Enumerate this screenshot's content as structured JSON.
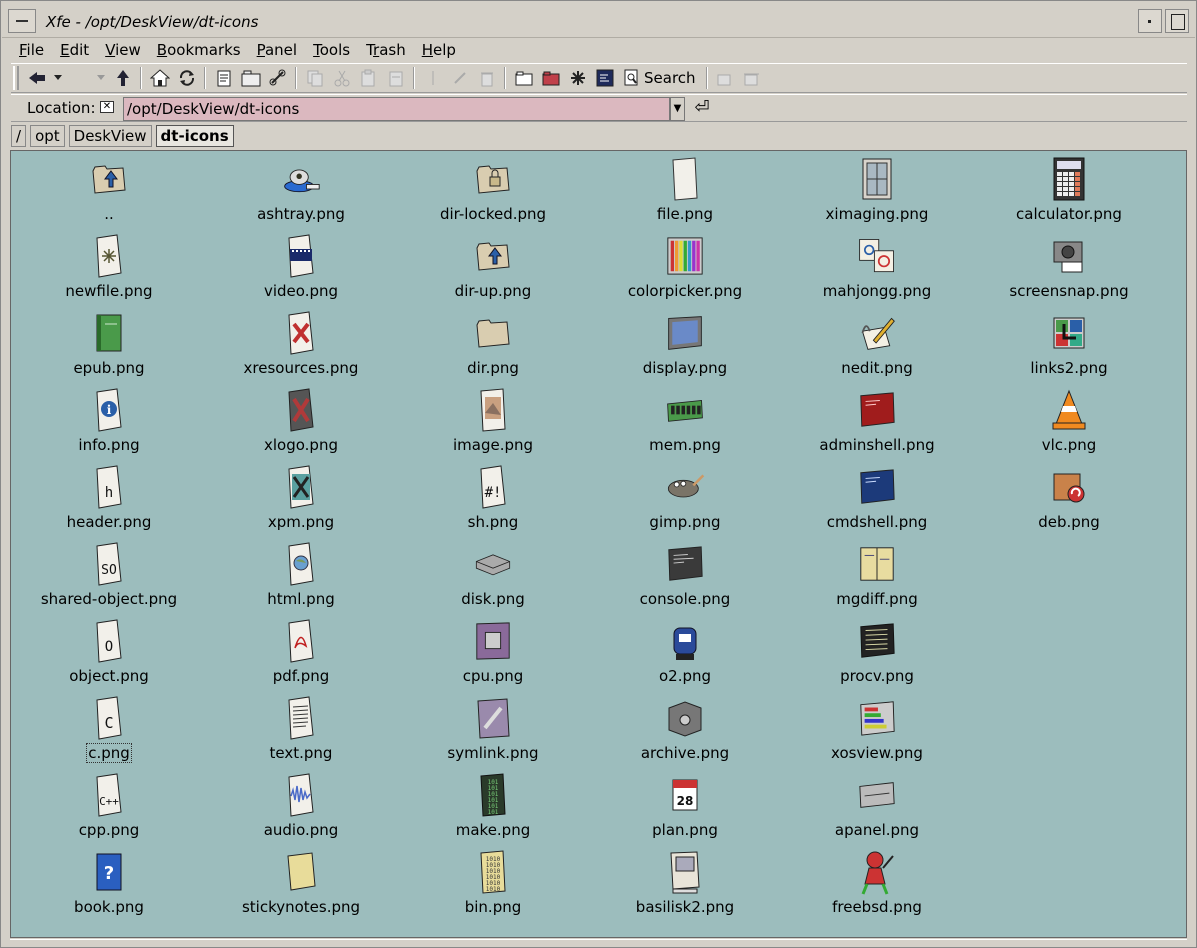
{
  "window": {
    "title": "Xfe - /opt/DeskView/dt-icons"
  },
  "menubar": [
    {
      "pre": "",
      "u": "F",
      "post": "ile"
    },
    {
      "pre": "",
      "u": "E",
      "post": "dit"
    },
    {
      "pre": "",
      "u": "V",
      "post": "iew"
    },
    {
      "pre": "",
      "u": "B",
      "post": "ookmarks"
    },
    {
      "pre": "",
      "u": "P",
      "post": "anel"
    },
    {
      "pre": "",
      "u": "T",
      "post": "ools"
    },
    {
      "pre": "T",
      "u": "r",
      "post": "ash"
    },
    {
      "pre": "",
      "u": "H",
      "post": "elp"
    }
  ],
  "toolbar": {
    "search_label": "Search"
  },
  "location": {
    "label": "Location:",
    "value": "/opt/DeskView/dt-icons"
  },
  "breadcrumbs": [
    "/",
    "opt",
    "DeskView",
    "dt-icons"
  ],
  "files": [
    [
      "..",
      "ashtray.png",
      "dir-locked.png",
      "file.png",
      "ximaging.png",
      "calculator.png"
    ],
    [
      "newfile.png",
      "video.png",
      "dir-up.png",
      "colorpicker.png",
      "mahjongg.png",
      "screensnap.png"
    ],
    [
      "epub.png",
      "xresources.png",
      "dir.png",
      "display.png",
      "nedit.png",
      "links2.png"
    ],
    [
      "info.png",
      "xlogo.png",
      "image.png",
      "mem.png",
      "adminshell.png",
      "vlc.png"
    ],
    [
      "header.png",
      "xpm.png",
      "sh.png",
      "gimp.png",
      "cmdshell.png",
      "deb.png"
    ],
    [
      "shared-object.png",
      "html.png",
      "disk.png",
      "console.png",
      "mgdiff.png",
      ""
    ],
    [
      "object.png",
      "pdf.png",
      "cpu.png",
      "o2.png",
      "procv.png",
      ""
    ],
    [
      "c.png",
      "text.png",
      "symlink.png",
      "archive.png",
      "xosview.png",
      ""
    ],
    [
      "cpp.png",
      "audio.png",
      "make.png",
      "plan.png",
      "apanel.png",
      ""
    ],
    [
      "book.png",
      "stickynotes.png",
      "bin.png",
      "basilisk2.png",
      "freebsd.png",
      ""
    ]
  ],
  "selected_file": "c.png",
  "colors": {
    "file_area_bg": "#9cbdbd",
    "location_bg": "#dbb8bf",
    "chrome": "#d4d0c8"
  }
}
